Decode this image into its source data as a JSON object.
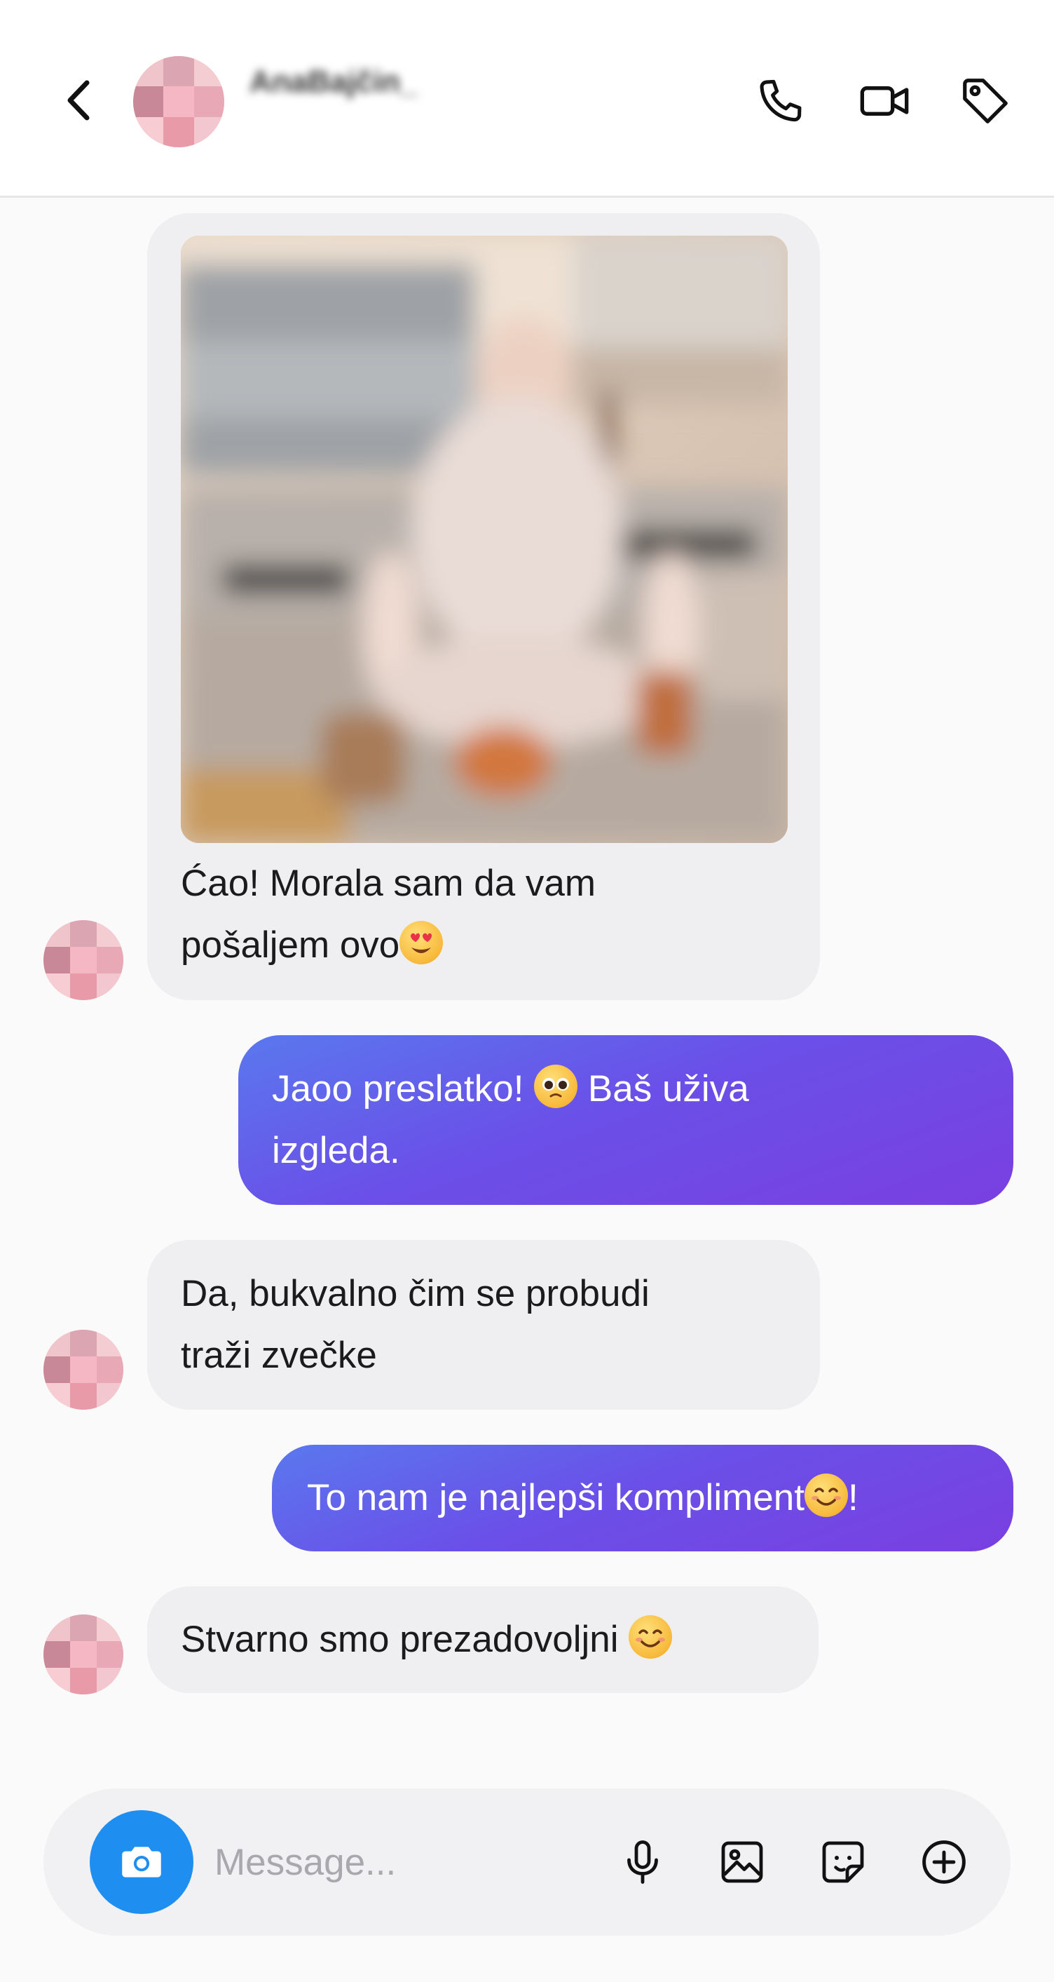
{
  "header": {
    "username": "AnaBajčin_",
    "back_label": "Back",
    "icons": [
      "chevron-left-icon",
      "phone-icon",
      "video-camera-icon",
      "tag-icon"
    ]
  },
  "messages": [
    {
      "direction": "incoming",
      "has_image": true,
      "line1": "Ćao! Morala sam da vam",
      "line2": "pošaljem ovo",
      "emoji": "heart-eyes"
    },
    {
      "direction": "outgoing",
      "line1a": "Jaoo preslatko! ",
      "emoji": "pleading-face",
      "line1b": " Baš uživa",
      "line2": "izgleda."
    },
    {
      "direction": "incoming",
      "line1": "Da, bukvalno čim se probudi",
      "line2": "traži zvečke"
    },
    {
      "direction": "outgoing",
      "text_a": "To nam je najlepši kompliment",
      "emoji": "smiling-face",
      "text_b": "!"
    },
    {
      "direction": "incoming",
      "text": "Stvarno smo prezadovoljni ",
      "emoji": "smiling-face"
    }
  ],
  "composer": {
    "placeholder": "Message...",
    "icons": [
      "camera-icon",
      "microphone-icon",
      "image-icon",
      "sticker-icon",
      "plus-circle-icon"
    ]
  },
  "colors": {
    "outgoing_gradient_start": "#5a78ee",
    "outgoing_gradient_end": "#7a3fe0",
    "incoming_bubble": "#efeff1",
    "camera_button": "#1e8ef1"
  }
}
